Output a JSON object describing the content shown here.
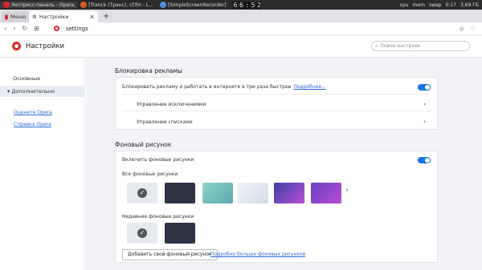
{
  "system_panel": {
    "windows": [
      {
        "label": "Экспресс-панель - Opera",
        "icon_color": "#e0242c"
      },
      {
        "label": "[Trance (Транс), cf.fm - L...",
        "icon_color": "#d45a28"
      },
      {
        "label": "[SimpleScreenRecorder]",
        "icon_color": "#4a8fd9"
      }
    ],
    "clock_digits": [
      "6",
      "6",
      ":",
      "5",
      "2"
    ],
    "indicators": [
      "cpu",
      "mem",
      "swap"
    ],
    "time": "0:17",
    "disk": "3,69 ГБ"
  },
  "tabs": [
    {
      "label": "Меню"
    },
    {
      "label": "Настройки"
    }
  ],
  "address": {
    "url": "settings"
  },
  "settings": {
    "title": "Настройки",
    "search_placeholder": "Поиск настроек"
  },
  "sidebar": {
    "items": [
      "Основные",
      "Дополнительно"
    ],
    "links": [
      "Оцените Opera",
      "Справка Opera"
    ]
  },
  "adblock": {
    "title": "Блокировка рекламы",
    "toggle_label": "Блокировать рекламу и работать в интернете в три раза быстрее",
    "more_link": "Подробнее...",
    "enabled": true,
    "rows": [
      "Управление исключениями",
      "Управление списками"
    ]
  },
  "wallpaper": {
    "title": "Фоновый рисунок",
    "toggle_label": "Включить фоновые рисунки",
    "enabled": true,
    "all_label": "Все фоновые рисунки",
    "recent_label": "Недавние фоновые рисунки",
    "add_button": "Добавить свой фоновый рисунок",
    "more_link": "Подробно больше фоновых рисунков",
    "thumb_colors": [
      "#e6e9ef",
      "#2c3344",
      "#6fb8b6",
      "#dfe6ee",
      "#3b3fa8",
      "#6a3fbf"
    ],
    "recent_colors": [
      "#e6e9ef",
      "#2c3344"
    ]
  }
}
